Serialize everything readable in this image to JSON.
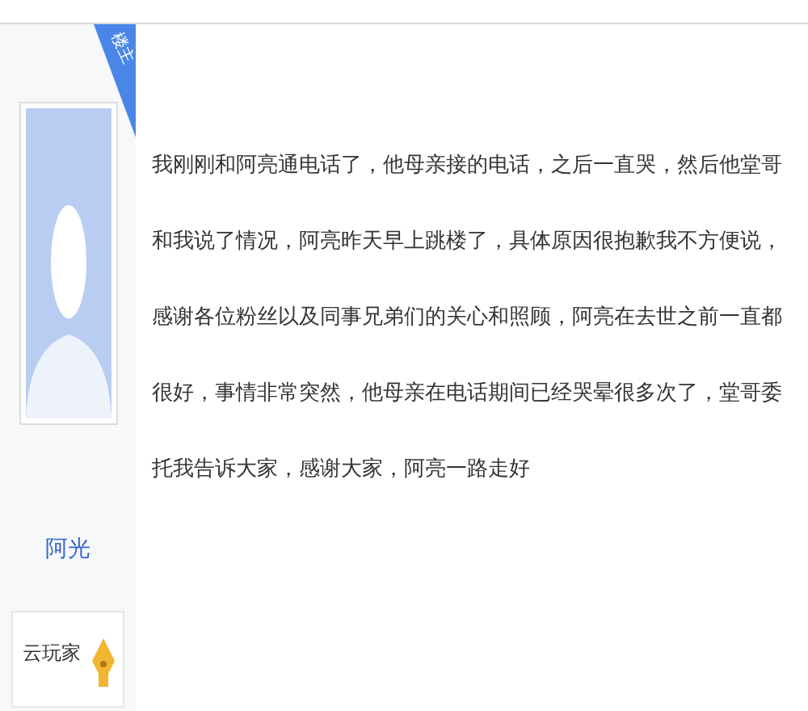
{
  "post": {
    "badge": "楼主",
    "author": {
      "name": "阿光",
      "level_title": "云玩家"
    },
    "content": "我刚刚和阿亮通电话了，他母亲接的电话，之后一直哭，然后他堂哥和我说了情况，阿亮昨天早上跳楼了，具体原因很抱歉我不方便说，感谢各位粉丝以及同事兄弟们的关心和照顾，阿亮在去世之前一直都很好，事情非常突然，他母亲在电话期间已经哭晕很多次了，堂哥委托我告诉大家，感谢大家，阿亮一路走好"
  }
}
